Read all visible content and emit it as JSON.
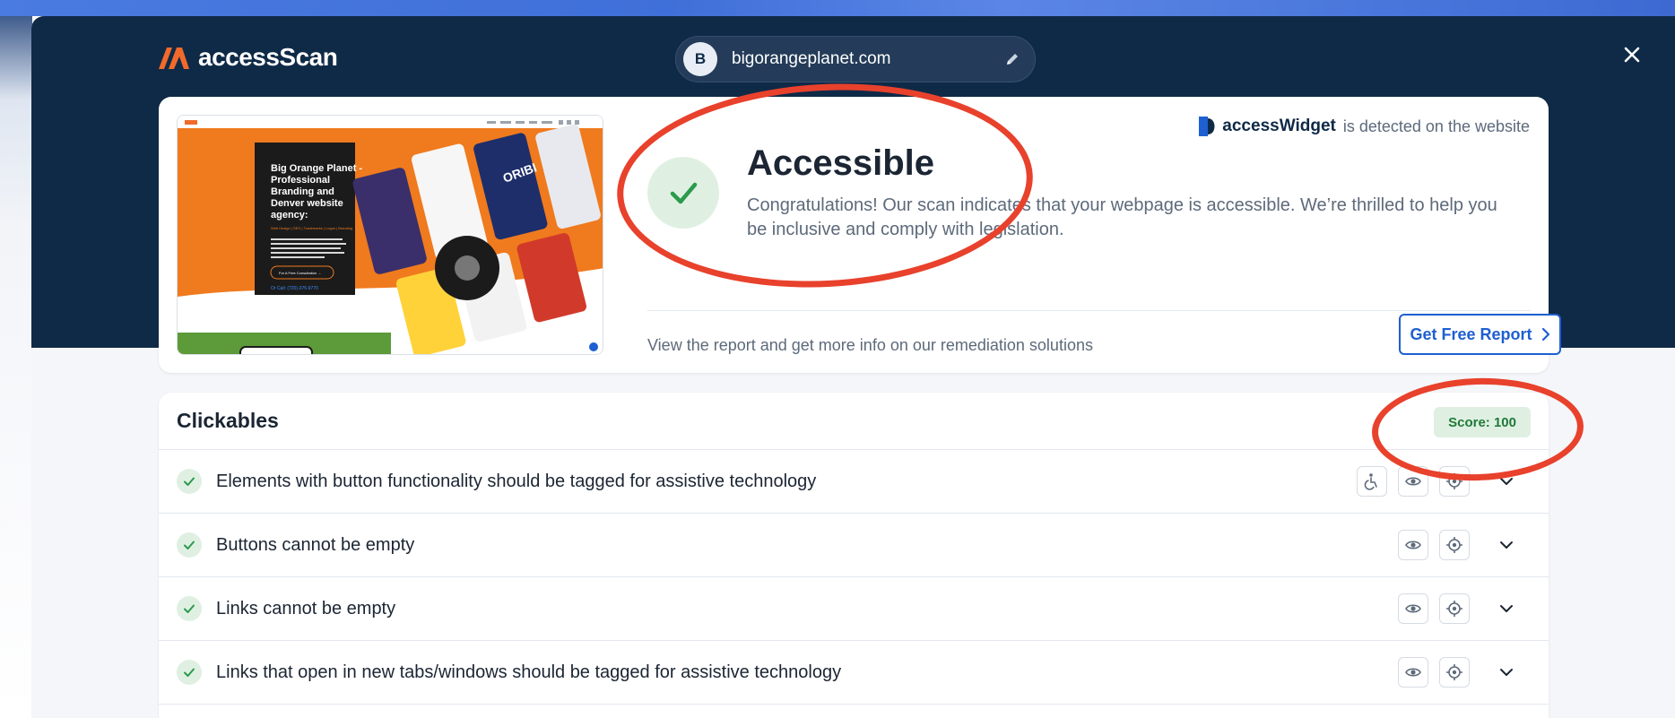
{
  "brand": {
    "name": "accessScan"
  },
  "url_bar": {
    "avatar_letter": "B",
    "url": "bigorangeplanet.com"
  },
  "result": {
    "status_title": "Accessible",
    "status_description": "Congratulations! Our scan indicates that your webpage is accessible. We’re thrilled to help you be inclusive and comply with legislation.",
    "detected_brand": "accessWidget",
    "detected_text": "is detected on the website",
    "report_text": "View the report and get more info on our remediation solutions",
    "report_button": "Get Free Report"
  },
  "thumbnail": {
    "headline_lines": [
      "Big Orange Planet -",
      "Professional",
      "Branding and",
      "Denver website",
      "agency:"
    ],
    "tag_line": "Web Design | SEO | Trademarks | Logos | Branding",
    "body": "Big Orange Planet is an Award Winning Denver based web design and marketing company that can help your business boost its digital presence. Learn the advantage of hiring our website consultants.",
    "cta": "For A Free Consultation →",
    "phone": "Or Call: (720)-375-9770",
    "card_label": "ORIBI"
  },
  "clickables": {
    "title": "Clickables",
    "score_label": "Score: 100",
    "rows": [
      {
        "text": "Elements with button functionality should be tagged for assistive technology",
        "tools": [
          "accessibility-icon",
          "eye-icon",
          "target-icon"
        ]
      },
      {
        "text": "Buttons cannot be empty",
        "tools": [
          "eye-icon",
          "target-icon"
        ]
      },
      {
        "text": "Links cannot be empty",
        "tools": [
          "eye-icon",
          "target-icon"
        ]
      },
      {
        "text": "Links that open in new tabs/windows should be tagged for assistive technology",
        "tools": [
          "eye-icon",
          "target-icon"
        ]
      }
    ]
  },
  "colors": {
    "header_bg": "#0f2a47",
    "accent_blue": "#1e5fd1",
    "success_green": "#2c9a4a",
    "success_bg": "#dff0e3",
    "annotation_red": "#e8412c",
    "brand_orange": "#f26a2b"
  }
}
